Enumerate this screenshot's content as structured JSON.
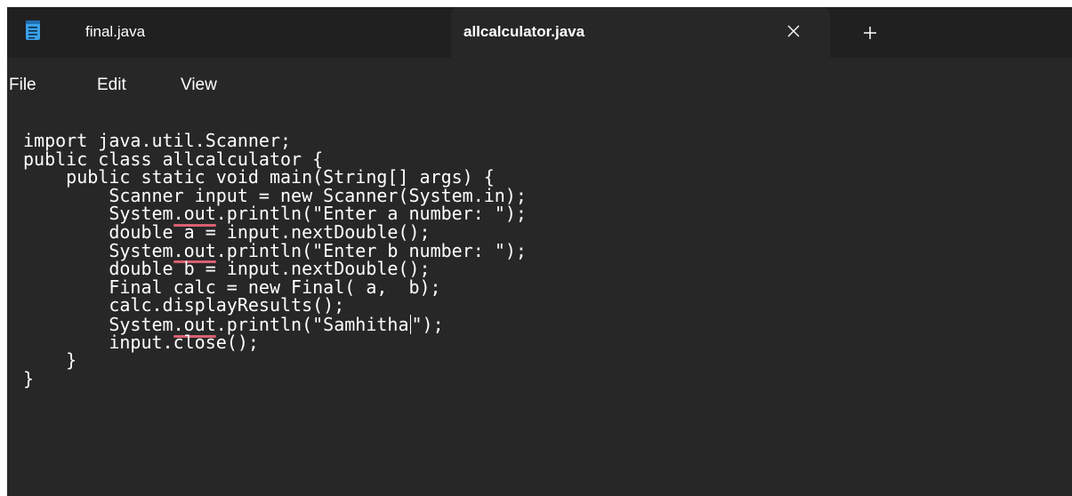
{
  "tabs": [
    {
      "label": "final.java",
      "active": false
    },
    {
      "label": "allcalculator.java",
      "active": true
    }
  ],
  "icons": {
    "app": "notepad-icon",
    "close": "close-icon",
    "add": "plus-icon"
  },
  "menu": {
    "file": "File",
    "edit": "Edit",
    "view": "View"
  },
  "editor": {
    "lines": {
      "l1": "import java.util.Scanner;",
      "l2": "public class allcalculator {",
      "l3": "    public static void main(String[] args) {",
      "l4": "        Scanner input = new Scanner(System.in);",
      "l5a": "        System",
      "l5b": ".out",
      "l5c": ".println(\"Enter a number: \");",
      "l6": "        double a = input.nextDouble();",
      "l7a": "        System",
      "l7b": ".out",
      "l7c": ".println(\"Enter b number: \");",
      "l8": "        double b = input.nextDouble();",
      "l9": "        Final calc = new Final( a,  b);",
      "l10": "        calc.displayResults();",
      "l11a": "        System",
      "l11b": ".out",
      "l11c": ".println(\"Samhitha",
      "l11d": "\");",
      "l12": "        input.close();",
      "l13": "    }",
      "l14": "}"
    }
  },
  "colors": {
    "background": "#272727",
    "tabbar": "#202020",
    "text": "#ffffff",
    "error_underline": "#d96073",
    "icon_accent": "#3aa0e8"
  }
}
